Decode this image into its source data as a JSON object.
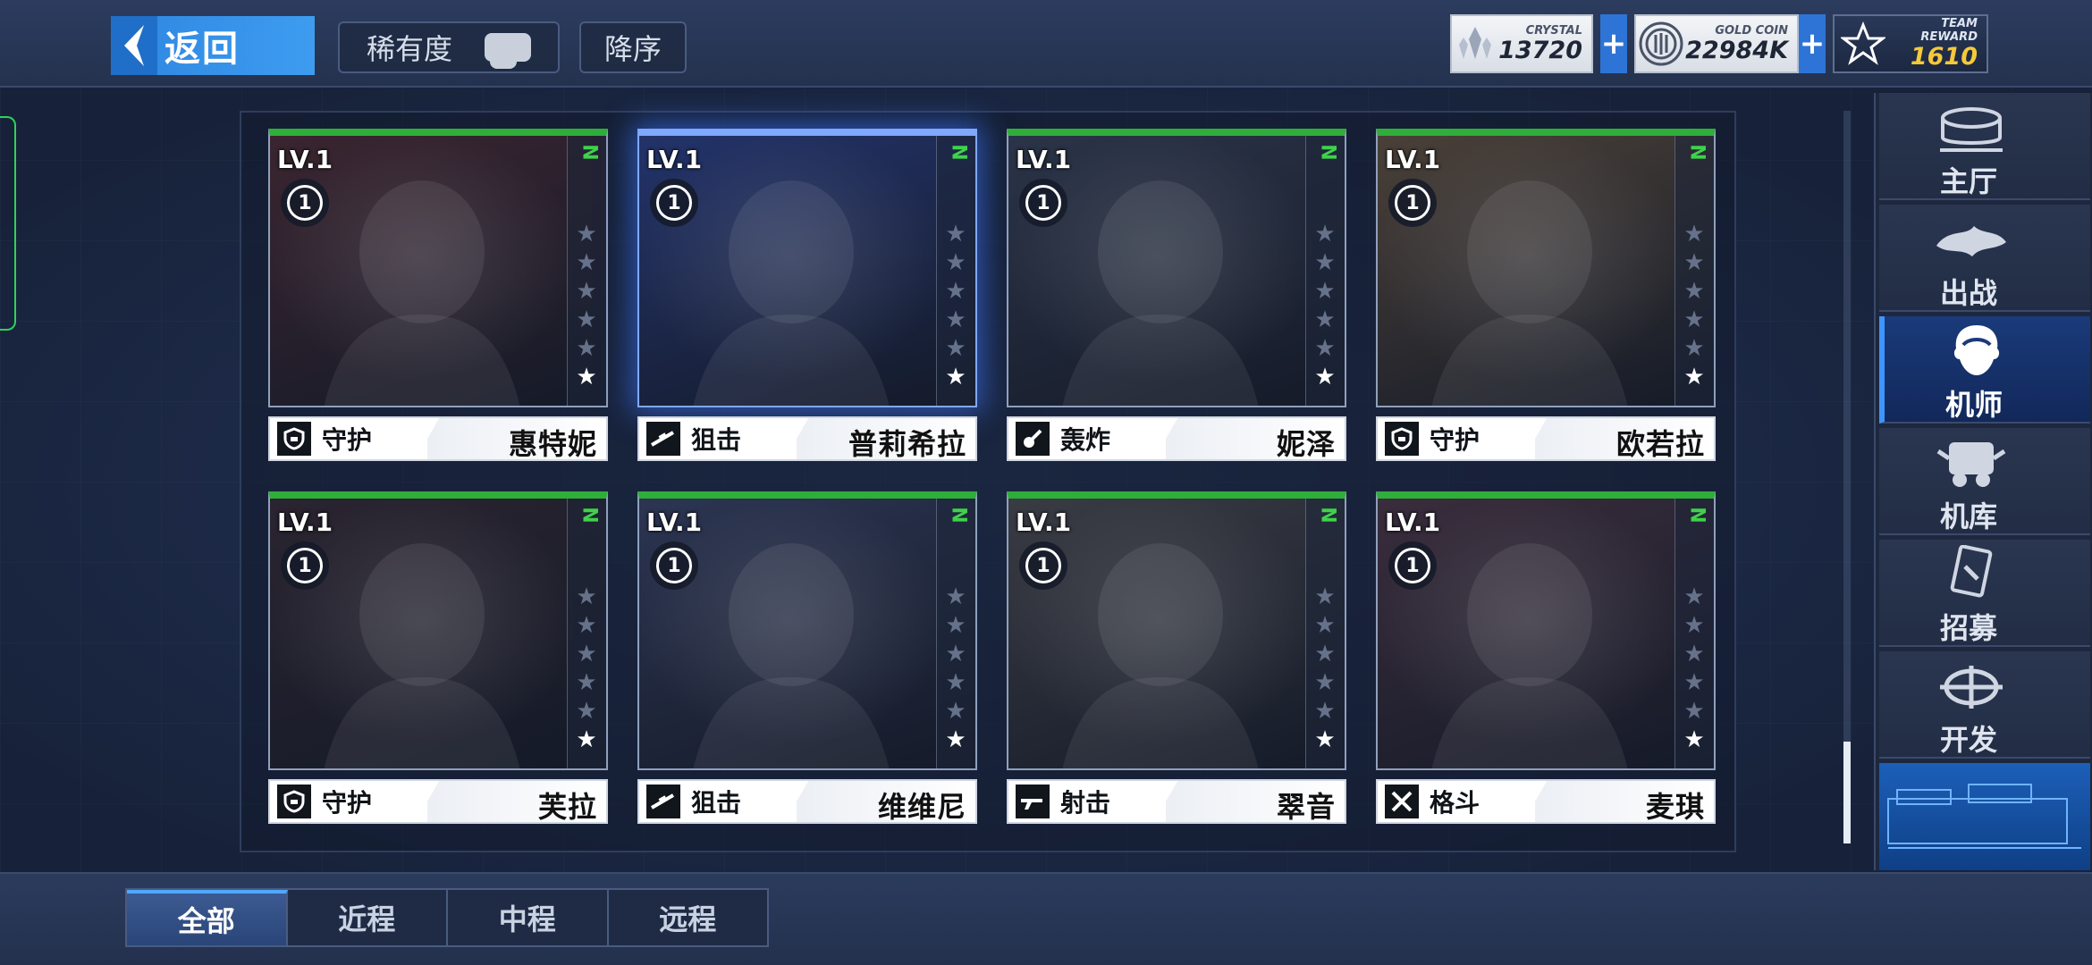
{
  "header": {
    "back_label": "返回",
    "rarity_label": "稀有度",
    "order_label": "降序"
  },
  "resources": {
    "crystal": {
      "caption": "CRYSTAL",
      "value": "13720"
    },
    "gold": {
      "caption": "GOLD COIN",
      "value": "22984K"
    },
    "team": {
      "caption": "TEAM REWARD",
      "value": "1610"
    },
    "plus": "+"
  },
  "cards": [
    {
      "level": "LV.1",
      "rank": "1",
      "grade": "N",
      "role": "守护",
      "name": "惠特妮",
      "stars_on": 1,
      "bg": "#3a2530"
    },
    {
      "level": "LV.1",
      "rank": "1",
      "grade": "N",
      "role": "狙击",
      "name": "普莉希拉",
      "stars_on": 1,
      "bg": "#23336a"
    },
    {
      "level": "LV.1",
      "rank": "1",
      "grade": "N",
      "role": "轰炸",
      "name": "妮泽",
      "stars_on": 1,
      "bg": "#2b3448"
    },
    {
      "level": "LV.1",
      "rank": "1",
      "grade": "N",
      "role": "守护",
      "name": "欧若拉",
      "stars_on": 1,
      "bg": "#4a4038"
    },
    {
      "level": "LV.1",
      "rank": "1",
      "grade": "N",
      "role": "守护",
      "name": "芙拉",
      "stars_on": 1,
      "bg": "#2a2430"
    },
    {
      "level": "LV.1",
      "rank": "1",
      "grade": "N",
      "role": "狙击",
      "name": "维维尼",
      "stars_on": 1,
      "bg": "#2c3552"
    },
    {
      "level": "LV.1",
      "rank": "1",
      "grade": "N",
      "role": "射击",
      "name": "翠音",
      "stars_on": 1,
      "bg": "#3a3c44"
    },
    {
      "level": "LV.1",
      "rank": "1",
      "grade": "N",
      "role": "格斗",
      "name": "麦琪",
      "stars_on": 1,
      "bg": "#3a2d3c"
    }
  ],
  "nav": [
    {
      "label": "主厅",
      "icon": "hall-icon"
    },
    {
      "label": "出战",
      "icon": "sortie-icon"
    },
    {
      "label": "机师",
      "icon": "pilot-icon",
      "active": true
    },
    {
      "label": "机库",
      "icon": "hangar-icon"
    },
    {
      "label": "招募",
      "icon": "recruit-icon"
    },
    {
      "label": "开发",
      "icon": "develop-icon"
    }
  ],
  "tabs": [
    {
      "label": "全部",
      "active": true
    },
    {
      "label": "近程"
    },
    {
      "label": "中程"
    },
    {
      "label": "远程"
    }
  ],
  "colors": {
    "grade_green": "#2fae3a",
    "accent_blue": "#2f86e0",
    "team_gold": "#f5c93a"
  }
}
